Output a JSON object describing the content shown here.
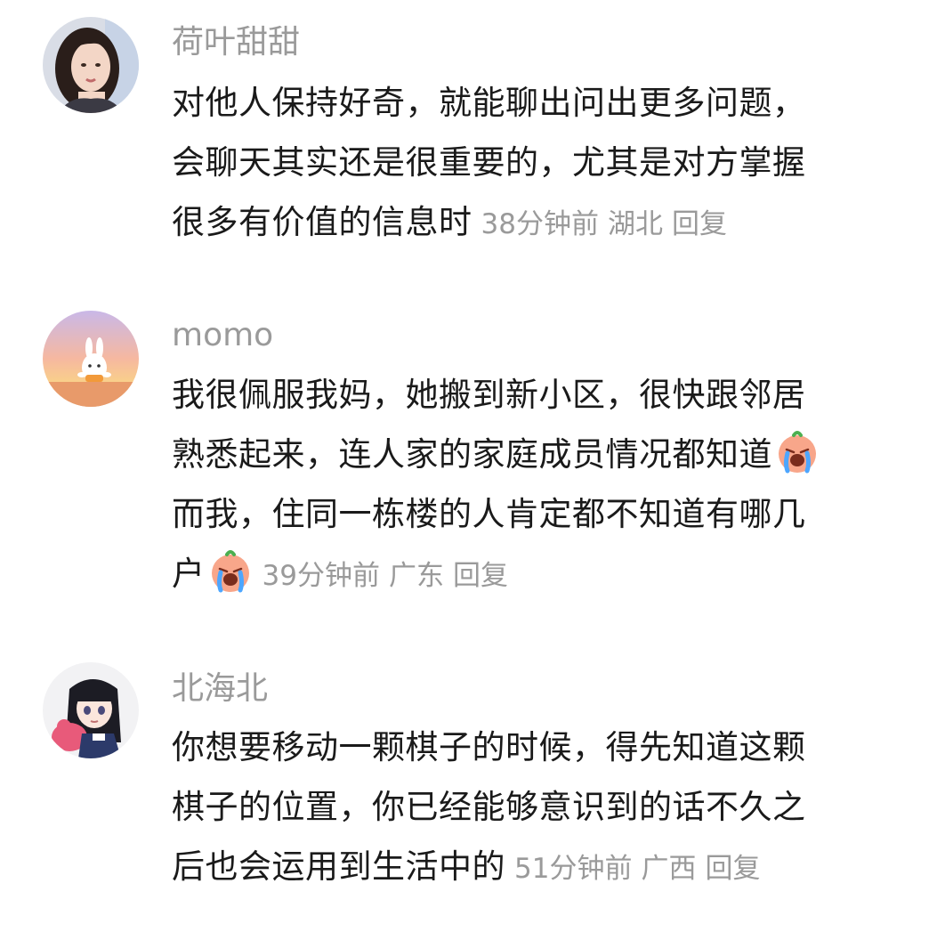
{
  "comments": [
    {
      "username": "荷叶甜甜",
      "lines": [
        "对他人保持好奇，就能聊出问出更多问题，",
        "会聊天其实还是很重要的，尤其是对方掌握",
        "很多有价值的信息时"
      ],
      "time": "38分钟前",
      "location": "湖北",
      "reply": "回复"
    },
    {
      "username": "momo",
      "lines": [
        "我很佩服我妈，她搬到新小区，很快跟邻居",
        "熟悉起来，连人家的家庭成员情况都知道",
        "而我，住同一栋楼的人肯定都不知道有哪几",
        "户"
      ],
      "emoji": "crying-face-emoji",
      "time": "39分钟前",
      "location": "广东",
      "reply": "回复"
    },
    {
      "username": "北海北",
      "lines": [
        "你想要移动一颗棋子的时候，得先知道这颗",
        "棋子的位置，你已经能够意识到的话不久之",
        "后也会运用到生活中的"
      ],
      "time": "51分钟前",
      "location": "广西",
      "reply": "回复"
    }
  ],
  "colors": {
    "username": "#9a9a9a",
    "text": "#1a1a1a",
    "meta": "#9a9a9a",
    "background": "#ffffff"
  }
}
